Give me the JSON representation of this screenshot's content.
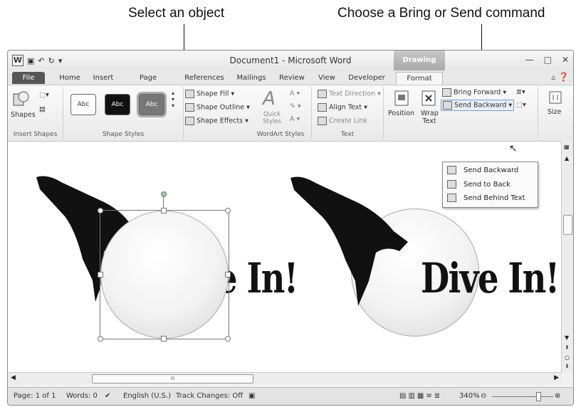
{
  "callouts": {
    "left": "Select an object",
    "right": "Choose a Bring or Send command"
  },
  "window": {
    "title": "Document1 - Microsoft Word",
    "contextual_tab": "Drawing Tools",
    "tabs": [
      "File",
      "Home",
      "Insert",
      "Page Layout",
      "References",
      "Mailings",
      "Review",
      "View",
      "Developer",
      "Format"
    ]
  },
  "ribbon": {
    "insert_shapes": {
      "label": "Insert Shapes",
      "shapes_button": "Shapes"
    },
    "shape_styles": {
      "label": "Shape Styles",
      "swatch": "Abc",
      "fill": "Shape Fill",
      "outline": "Shape Outline",
      "effects": "Shape Effects"
    },
    "wordart_styles": {
      "label": "WordArt Styles",
      "quick_styles": "Quick Styles"
    },
    "text": {
      "label": "Text",
      "direction": "Text Direction",
      "align": "Align Text",
      "link": "Create Link"
    },
    "arrange": {
      "position": "Position",
      "wrap_text": "Wrap Text",
      "bring_forward": "Bring Forward",
      "send_backward": "Send Backward"
    },
    "size": {
      "label": "Size"
    }
  },
  "send_menu": {
    "items": [
      "Send Backward",
      "Send to Back",
      "Send Behind Text"
    ]
  },
  "document": {
    "left_text": "e In!",
    "right_text": "Dive In!"
  },
  "statusbar": {
    "page": "Page: 1 of 1",
    "words": "Words: 0",
    "language": "English (U.S.)",
    "track_changes": "Track Changes: Off",
    "zoom": "340%",
    "scroll_marker": "III"
  }
}
